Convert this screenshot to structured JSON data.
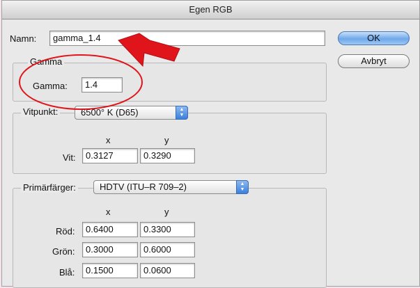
{
  "window": {
    "title": "Egen RGB"
  },
  "name_field": {
    "label": "Namn:",
    "value": "gamma_1.4"
  },
  "buttons": {
    "ok": "OK",
    "cancel": "Avbryt"
  },
  "gamma_group": {
    "legend": "Gamma",
    "label": "Gamma:",
    "value": "1.4"
  },
  "whitepoint_group": {
    "label": "Vitpunkt:",
    "selected": "6500° K (D65)",
    "col_x": "x",
    "col_y": "y",
    "row": {
      "label": "Vit:",
      "x": "0.3127",
      "y": "0.3290"
    }
  },
  "primaries_group": {
    "label": "Primärfärger:",
    "selected": "HDTV (ITU–R 709–2)",
    "col_x": "x",
    "col_y": "y",
    "rows": [
      {
        "label": "Röd:",
        "x": "0.6400",
        "y": "0.3300"
      },
      {
        "label": "Grön:",
        "x": "0.3000",
        "y": "0.6000"
      },
      {
        "label": "Blå:",
        "x": "0.1500",
        "y": "0.0600"
      }
    ]
  },
  "colors": {
    "annotation_red": "#e0151b",
    "background_pink": "#f4e3ea"
  }
}
